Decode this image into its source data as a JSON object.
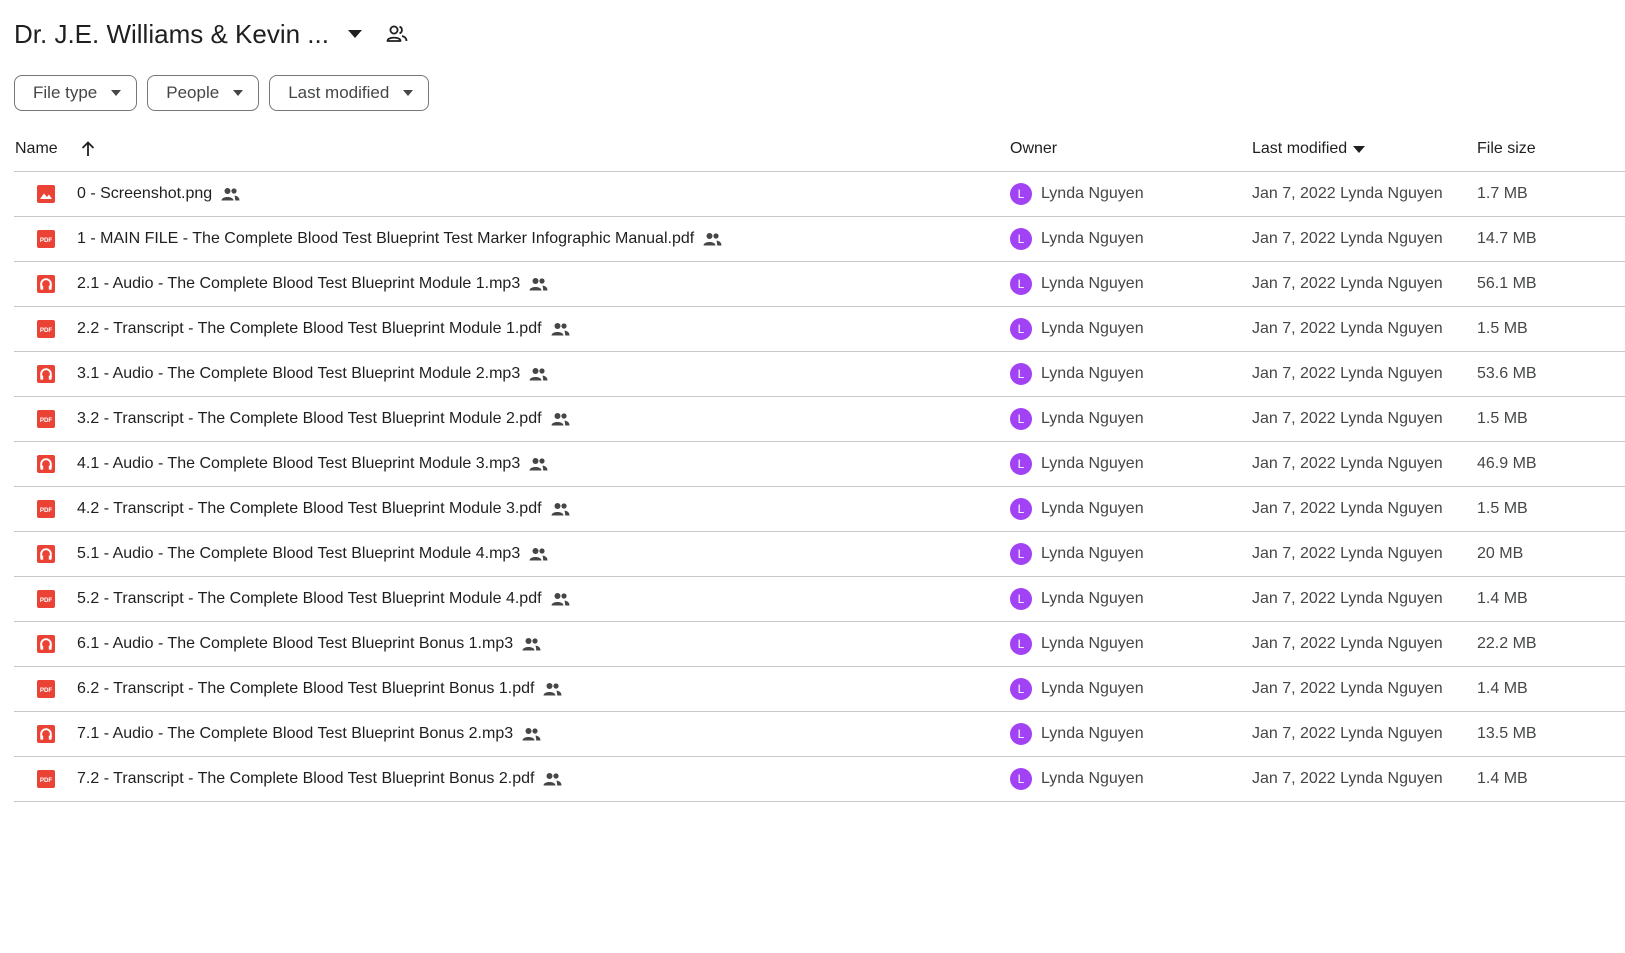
{
  "header": {
    "folder_title": "Dr. J.E. Williams & Kevin ...",
    "dropdown_icon": "arrow-drop-down-icon",
    "shared_icon": "people-outline-icon"
  },
  "filters": [
    {
      "label": "File type"
    },
    {
      "label": "People"
    },
    {
      "label": "Last modified"
    }
  ],
  "columns": {
    "name": "Name",
    "owner": "Owner",
    "last_modified": "Last modified",
    "file_size": "File size"
  },
  "colors": {
    "icon_red": "#ea4335",
    "avatar_purple": "#a142f4",
    "divider": "#c7c7c7"
  },
  "files": [
    {
      "name": "0 - Screenshot.png",
      "type": "image",
      "owner_initial": "L",
      "owner": "Lynda Nguyen",
      "modified": "Jan 7, 2022 Lynda Nguyen",
      "size": "1.7 MB"
    },
    {
      "name": "1 - MAIN FILE - The Complete Blood Test Blueprint Test Marker Infographic Manual.pdf",
      "type": "pdf",
      "owner_initial": "L",
      "owner": "Lynda Nguyen",
      "modified": "Jan 7, 2022 Lynda Nguyen",
      "size": "14.7 MB"
    },
    {
      "name": "2.1 - Audio - The Complete Blood Test Blueprint Module 1.mp3",
      "type": "audio",
      "owner_initial": "L",
      "owner": "Lynda Nguyen",
      "modified": "Jan 7, 2022 Lynda Nguyen",
      "size": "56.1 MB"
    },
    {
      "name": "2.2 - Transcript - The Complete Blood Test Blueprint Module 1.pdf",
      "type": "pdf",
      "owner_initial": "L",
      "owner": "Lynda Nguyen",
      "modified": "Jan 7, 2022 Lynda Nguyen",
      "size": "1.5 MB"
    },
    {
      "name": "3.1 - Audio - The Complete Blood Test Blueprint Module 2.mp3",
      "type": "audio",
      "owner_initial": "L",
      "owner": "Lynda Nguyen",
      "modified": "Jan 7, 2022 Lynda Nguyen",
      "size": "53.6 MB"
    },
    {
      "name": "3.2 - Transcript - The Complete Blood Test Blueprint Module 2.pdf",
      "type": "pdf",
      "owner_initial": "L",
      "owner": "Lynda Nguyen",
      "modified": "Jan 7, 2022 Lynda Nguyen",
      "size": "1.5 MB"
    },
    {
      "name": "4.1 - Audio - The Complete Blood Test Blueprint Module 3.mp3",
      "type": "audio",
      "owner_initial": "L",
      "owner": "Lynda Nguyen",
      "modified": "Jan 7, 2022 Lynda Nguyen",
      "size": "46.9 MB"
    },
    {
      "name": "4.2 - Transcript - The Complete Blood Test Blueprint Module 3.pdf",
      "type": "pdf",
      "owner_initial": "L",
      "owner": "Lynda Nguyen",
      "modified": "Jan 7, 2022 Lynda Nguyen",
      "size": "1.5 MB"
    },
    {
      "name": "5.1 - Audio - The Complete Blood Test Blueprint Module 4.mp3",
      "type": "audio",
      "owner_initial": "L",
      "owner": "Lynda Nguyen",
      "modified": "Jan 7, 2022 Lynda Nguyen",
      "size": "20 MB"
    },
    {
      "name": "5.2 - Transcript - The Complete Blood Test Blueprint Module 4.pdf",
      "type": "pdf",
      "owner_initial": "L",
      "owner": "Lynda Nguyen",
      "modified": "Jan 7, 2022 Lynda Nguyen",
      "size": "1.4 MB"
    },
    {
      "name": "6.1 - Audio - The Complete Blood Test Blueprint Bonus 1.mp3",
      "type": "audio",
      "owner_initial": "L",
      "owner": "Lynda Nguyen",
      "modified": "Jan 7, 2022 Lynda Nguyen",
      "size": "22.2 MB"
    },
    {
      "name": "6.2 - Transcript - The Complete Blood Test Blueprint Bonus 1.pdf",
      "type": "pdf",
      "owner_initial": "L",
      "owner": "Lynda Nguyen",
      "modified": "Jan 7, 2022 Lynda Nguyen",
      "size": "1.4 MB"
    },
    {
      "name": "7.1 - Audio - The Complete Blood Test Blueprint Bonus 2.mp3",
      "type": "audio",
      "owner_initial": "L",
      "owner": "Lynda Nguyen",
      "modified": "Jan 7, 2022 Lynda Nguyen",
      "size": "13.5 MB"
    },
    {
      "name": "7.2 - Transcript - The Complete Blood Test Blueprint Bonus 2.pdf",
      "type": "pdf",
      "owner_initial": "L",
      "owner": "Lynda Nguyen",
      "modified": "Jan 7, 2022 Lynda Nguyen",
      "size": "1.4 MB"
    }
  ]
}
